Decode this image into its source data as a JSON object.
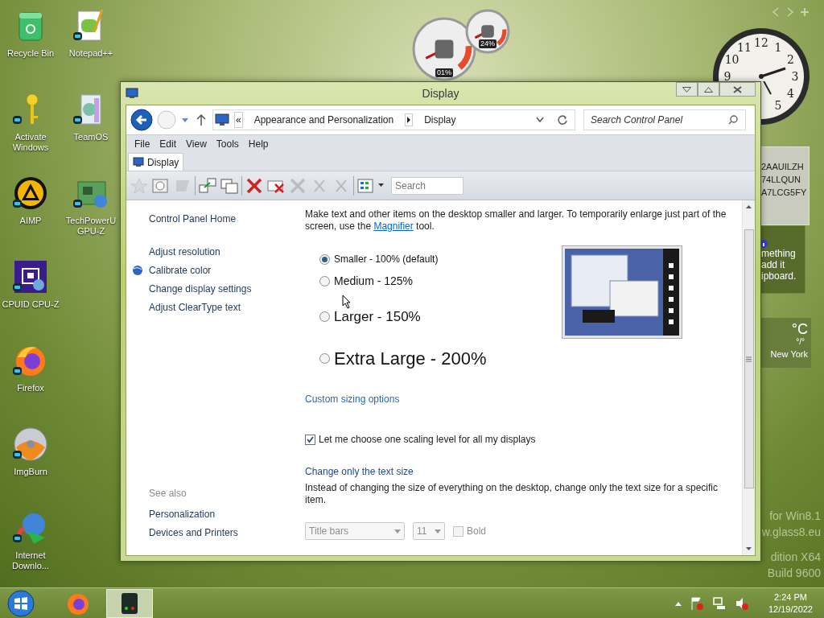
{
  "desktop": {
    "icon_columns": [
      {
        "icons": [
          {
            "label": "Recycle Bin",
            "kind": "recycle-bin",
            "shortcut": false
          },
          {
            "label": "Activate Windows",
            "kind": "key",
            "shortcut": true
          },
          {
            "label": "AIMP",
            "kind": "aimp",
            "shortcut": true
          },
          {
            "label": "CPUID CPU-Z",
            "kind": "chip",
            "shortcut": true
          },
          {
            "label": "Firefox",
            "kind": "firefox",
            "shortcut": true
          },
          {
            "label": "ImgBurn",
            "kind": "disc",
            "shortcut": true
          },
          {
            "label": "Internet Downlo...",
            "kind": "globe",
            "shortcut": true
          }
        ]
      },
      {
        "icons": [
          {
            "label": "Notepad++",
            "kind": "notepad",
            "shortcut": true
          },
          {
            "label": "TeamOS",
            "kind": "book",
            "shortcut": true
          },
          {
            "label": "TechPowerU GPU-Z",
            "kind": "board",
            "shortcut": true
          }
        ]
      }
    ],
    "cpu_meter": {
      "gauges": [
        {
          "reading": "01%"
        },
        {
          "reading": "24%"
        }
      ]
    },
    "clock": {
      "numerals": [
        "12",
        "1",
        "2",
        "3",
        "4",
        "5",
        "9",
        "10",
        "11"
      ]
    },
    "text_gadget": {
      "lines": [
        "2AAUILZH",
        "74LLQUN",
        "A7LCG5FY"
      ]
    },
    "clipboard_gadget": {
      "lines": [
        "mething",
        "add it",
        "ipboard."
      ]
    },
    "weather": {
      "unit": "°C",
      "range": "°/°",
      "city": "New York"
    },
    "build_text": [
      "for Win8.1",
      "w.glass8.eu",
      "dition X64",
      "Build 9600"
    ]
  },
  "window": {
    "title": "Display",
    "address": {
      "overflow": "«",
      "crumbs": [
        "Appearance and Personalization",
        "Display"
      ]
    },
    "search": {
      "placeholder": "Search Control Panel"
    },
    "menu": [
      "File",
      "Edit",
      "View",
      "Tools",
      "Help"
    ],
    "tab": {
      "label": "Display"
    },
    "toolbar": {
      "search_placeholder": "Search"
    },
    "nav": {
      "home": "Control Panel Home",
      "tasks": [
        {
          "label": "Adjust resolution",
          "icon": false
        },
        {
          "label": "Calibrate color",
          "icon": true
        },
        {
          "label": "Change display settings",
          "icon": false
        },
        {
          "label": "Adjust ClearType text",
          "icon": false
        }
      ],
      "see_also": "See also",
      "links": [
        "Personalization",
        "Devices and Printers"
      ]
    },
    "content": {
      "intro": {
        "before": "Make text and other items on the desktop smaller and larger. To temporarily enlarge just part of the screen, use the",
        "link": "Magnifier",
        "after": "tool."
      },
      "sizes": [
        {
          "label": "Smaller - 100% (default)",
          "selected": true
        },
        {
          "label": "Medium - 125%",
          "selected": false
        },
        {
          "label": "Larger - 150%",
          "selected": false
        },
        {
          "label": "Extra Large - 200%",
          "selected": false
        }
      ],
      "custom_link": "Custom sizing options",
      "one_level": {
        "label": "Let me choose one scaling level for all my displays",
        "checked": true
      },
      "text_size_heading": "Change only the text size",
      "text_size_description": "Instead of changing the size of everything on the desktop, change only the text size for a specific item.",
      "item_select": {
        "value": "Title bars",
        "disabled": true
      },
      "size_select": {
        "value": "11",
        "disabled": true
      },
      "bold": {
        "label": "Bold",
        "checked": false,
        "disabled": true
      }
    }
  },
  "taskbar": {
    "apps": [
      {
        "kind": "firefox",
        "selected": false
      },
      {
        "kind": "gauge-app",
        "selected": true
      }
    ],
    "time": "2:24 PM",
    "date": "12/19/2022"
  }
}
